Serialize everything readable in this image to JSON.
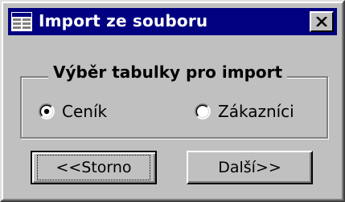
{
  "window": {
    "title": "Import ze souboru",
    "close_symbol": "×",
    "icon": "table-icon"
  },
  "group": {
    "title": "Výběr tabulky pro import",
    "options": [
      {
        "label": "Ceník",
        "selected": true
      },
      {
        "label": "Zákazníci",
        "selected": false
      }
    ]
  },
  "buttons": {
    "back_label": "<<Storno",
    "next_label": "Další>>"
  }
}
